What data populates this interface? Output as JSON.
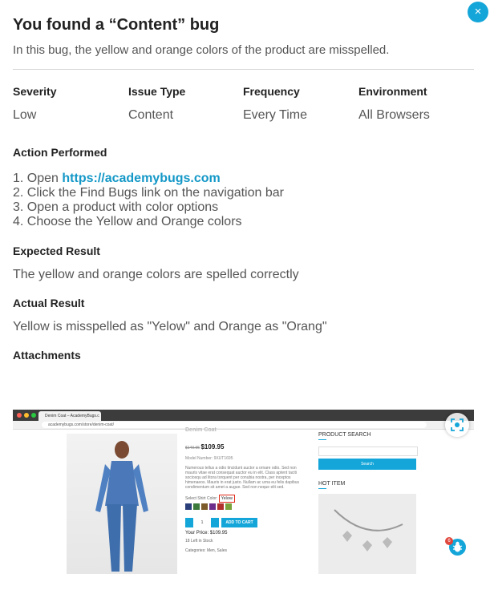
{
  "header": {
    "title": "You found a “Content” bug",
    "description": "In this bug, the yellow and orange colors of the product are misspelled.",
    "close_label": "×"
  },
  "meta": [
    {
      "label": "Severity",
      "value": "Low"
    },
    {
      "label": "Issue Type",
      "value": "Content"
    },
    {
      "label": "Frequency",
      "value": "Every Time"
    },
    {
      "label": "Environment",
      "value": "All Browsers"
    }
  ],
  "action": {
    "heading": "Action Performed",
    "steps": [
      {
        "num": "1.",
        "text": "Open ",
        "link": "https://academybugs.com"
      },
      {
        "num": "2.",
        "text": "Click the Find Bugs link on the navigation bar"
      },
      {
        "num": "3.",
        "text": "Open a product with color options"
      },
      {
        "num": "4.",
        "text": "Choose the Yellow and Orange colors"
      }
    ]
  },
  "expected": {
    "heading": "Expected Result",
    "text": "The yellow and orange colors are spelled correctly"
  },
  "actual": {
    "heading": "Actual Result",
    "text": "Yellow is misspelled as \"Yelow\" and Orange as \"Orang\""
  },
  "attachments": {
    "heading": "Attachments",
    "screenshot": {
      "tab_title": "Denim Coat – AcademyBugs.c",
      "url": "academybugs.com/store/denim-coat/",
      "product_title": "Denim Coat",
      "old_price": "$149.95",
      "price": "$109.95",
      "model": "Model Number: 9XUT1695",
      "body": "Numerous tellus a odio tincidunt auctor a ornare odio. Sed non mauris vitae erat consequat auctor eu in elit. Class aptent taciti sociosqu ad litora torquent per conubia nostra, per inceptos himenaeos. Mauris in erat justo. Nullam ac urna eu felis dapibus condimentum sit amet a augue. Sed non neque elit sed.",
      "color_label": "Select Shirt Color:",
      "selected_color": "Yelow",
      "qty": "1",
      "add_to_cart": "ADD TO CART",
      "your_price": "Your Price: $109.95",
      "stock": "18 Left in Stock",
      "category": "Categories: Men, Sales",
      "search_heading": "PRODUCT SEARCH",
      "search_button": "Search",
      "hot_item": "HOT ITEM",
      "fab_badge": "6"
    }
  },
  "colors": {
    "accent": "#14a6d9",
    "heading": "#222222",
    "body_text": "#555555",
    "link": "#1498c7"
  }
}
